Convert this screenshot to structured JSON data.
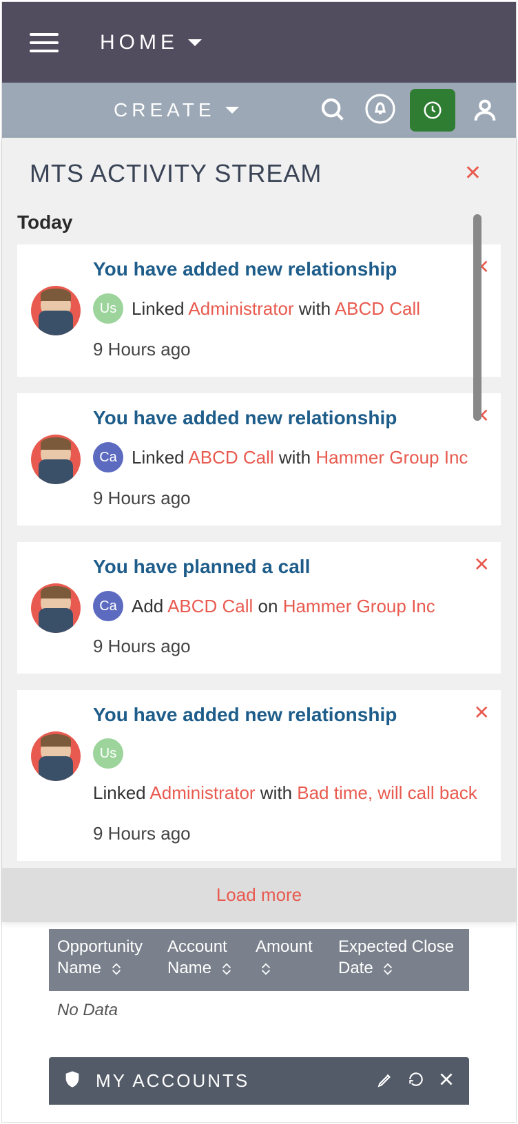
{
  "topbar": {
    "home": "HOME"
  },
  "secondbar": {
    "create": "CREATE"
  },
  "stream": {
    "title": "MTS ACTIVITY STREAM",
    "today": "Today",
    "load_more": "Load more",
    "items": [
      {
        "title": "You have added new relationship",
        "badge": "Us",
        "badge_color": "green",
        "prefix": "Linked ",
        "link1": "Administrator",
        "mid": " with ",
        "link2": "ABCD Call",
        "time": "9 Hours ago"
      },
      {
        "title": "You have added new relationship",
        "badge": "Ca",
        "badge_color": "purple",
        "prefix": "Linked ",
        "link1": "ABCD Call",
        "mid": " with ",
        "link2": "Hammer Group Inc",
        "time": "9 Hours ago"
      },
      {
        "title": "You have planned a call",
        "badge": "Ca",
        "badge_color": "purple",
        "prefix": "Add ",
        "link1": "ABCD Call",
        "mid": " on ",
        "link2": "Hammer Group Inc",
        "time": "9 Hours ago"
      },
      {
        "title": "You have added new relationship",
        "badge": "Us",
        "badge_color": "green",
        "prefix": "Linked ",
        "link1": "Administrator",
        "mid": " with ",
        "link2": "Bad time, will call back",
        "time": "9 Hours ago"
      }
    ]
  },
  "opportunities": {
    "cols": [
      "Opportunity Name",
      "Account Name",
      "Amount",
      "Expected Close Date"
    ],
    "no_data": "No Data"
  },
  "accounts": {
    "title": "MY ACCOUNTS"
  }
}
